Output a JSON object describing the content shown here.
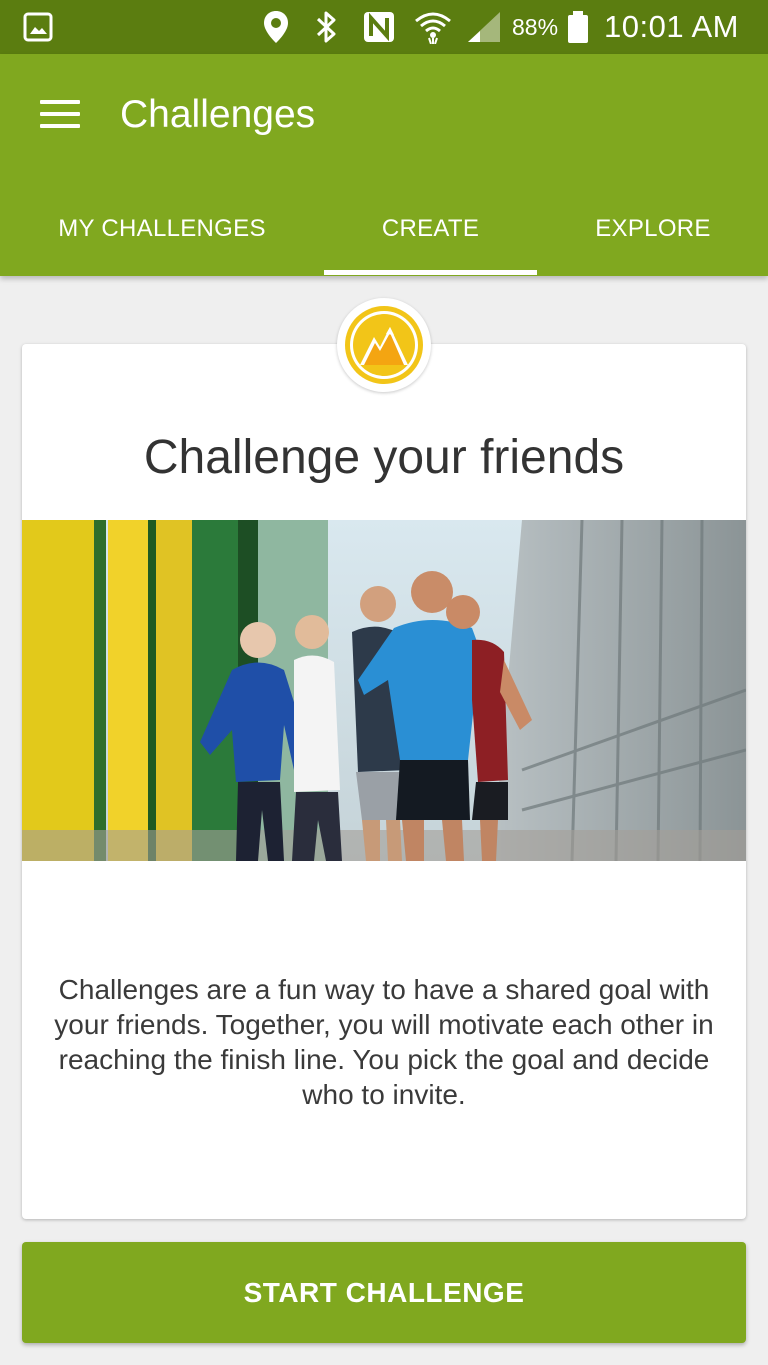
{
  "status_bar": {
    "icons": [
      "gallery-icon",
      "location-icon",
      "bluetooth-icon",
      "nfc-icon",
      "wifi-icon",
      "signal-icon",
      "battery-icon"
    ],
    "battery": "88%",
    "time": "10:01 AM"
  },
  "app_bar": {
    "title": "Challenges",
    "menu_icon": "hamburger-menu-icon",
    "background_color": "#80a81f"
  },
  "tabs": [
    {
      "label": "MY CHALLENGES",
      "selected": false
    },
    {
      "label": "CREATE",
      "selected": true
    },
    {
      "label": "EXPLORE",
      "selected": false
    }
  ],
  "card": {
    "badge_icon": "mountain-badge-icon",
    "title": "Challenge your friends",
    "image": "group-of-runners-photo",
    "description": "Challenges are a fun way to have a shared goal with your friends. Together, you will motivate each other in reaching the finish line. You pick the goal and decide who to invite."
  },
  "cta": {
    "label": "START CHALLENGE"
  },
  "colors": {
    "status_bar": "#5b7d10",
    "primary": "#80a81f",
    "badge_yellow": "#f2c518",
    "background": "#efefef"
  }
}
